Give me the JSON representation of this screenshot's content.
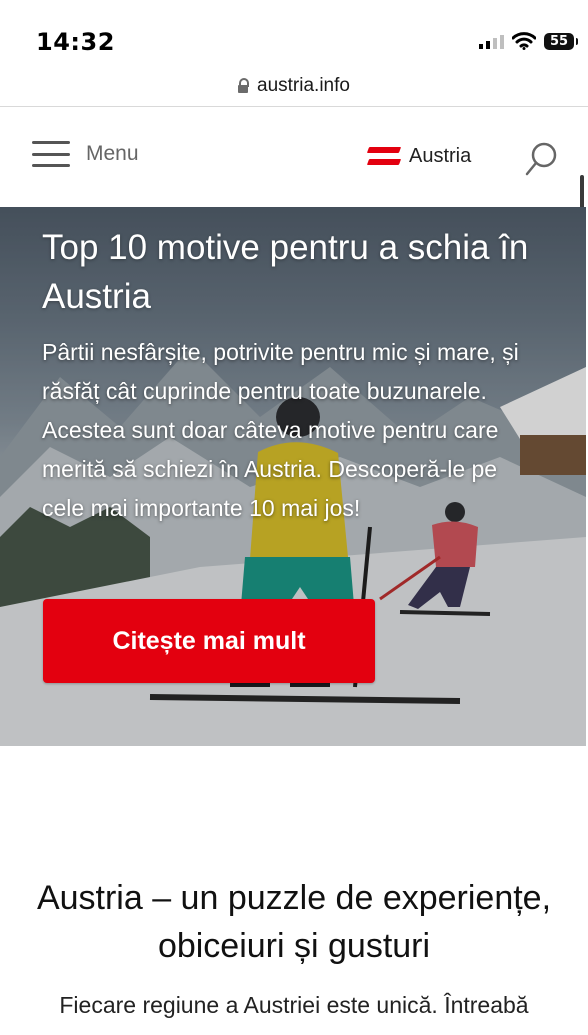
{
  "status_bar": {
    "time": "14:32",
    "battery": "55",
    "icons": [
      "signal-icon",
      "wifi-icon",
      "battery-icon"
    ]
  },
  "browser": {
    "url": "austria.info",
    "lock_icon": "lock-icon"
  },
  "header": {
    "menu_label": "Menu",
    "logo_text": "Austria",
    "brand_color": "#e3000f",
    "icons": [
      "hamburger-icon",
      "austria-logo-icon",
      "search-icon"
    ]
  },
  "hero": {
    "title": "Top 10 motive pentru a schia în Austria",
    "description": "Pârtii nesfârșite, potrivite pentru mic și mare, și răsfăț cât cuprinde pentru toate buzunarele. Acestea sunt doar câteva motive pentru care merită să schiezi în Austria. Descoperă-le pe cele mai importante 10 mai jos!",
    "cta_label": "Citește mai mult",
    "cta_color": "#e3000f"
  },
  "section": {
    "title": "Austria – un puzzle de experiențe, obiceiuri și gusturi",
    "lead": "Fiecare regiune a Austriei este unică. Întreabă"
  }
}
